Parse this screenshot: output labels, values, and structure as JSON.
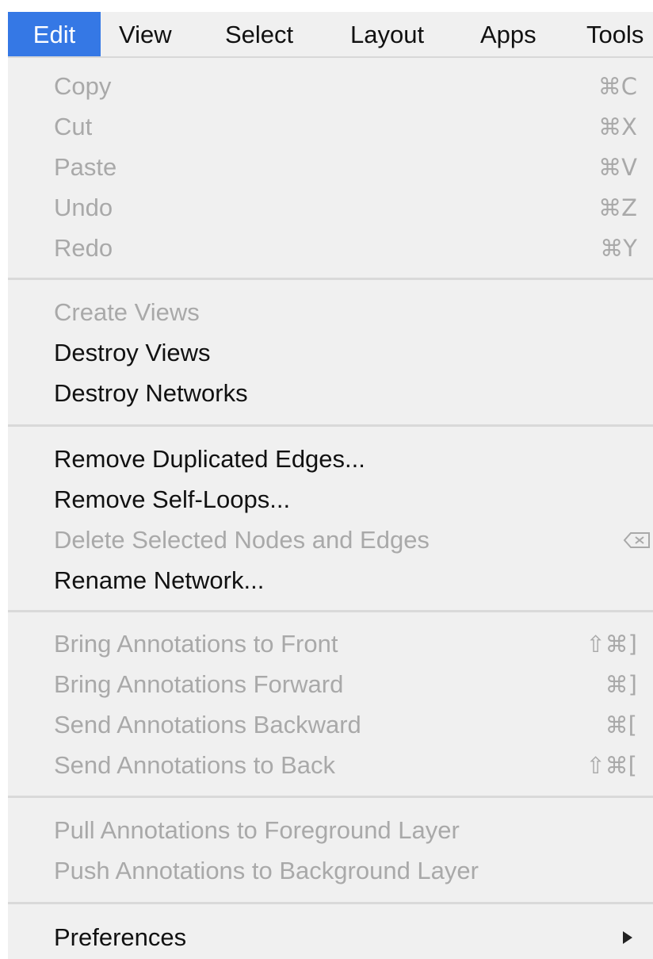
{
  "menubar": {
    "items": [
      {
        "label": "Edit",
        "active": true
      },
      {
        "label": "View",
        "active": false
      },
      {
        "label": "Select",
        "active": false
      },
      {
        "label": "Layout",
        "active": false
      },
      {
        "label": "Apps",
        "active": false
      },
      {
        "label": "Tools",
        "active": false
      }
    ]
  },
  "menu": {
    "groups": [
      {
        "items": [
          {
            "label": "Copy",
            "enabled": false,
            "shortcut": "⌘C"
          },
          {
            "label": "Cut",
            "enabled": false,
            "shortcut": "⌘X"
          },
          {
            "label": "Paste",
            "enabled": false,
            "shortcut": "⌘V"
          },
          {
            "label": "Undo",
            "enabled": false,
            "shortcut": "⌘Z"
          },
          {
            "label": "Redo",
            "enabled": false,
            "shortcut": "⌘Y"
          }
        ]
      },
      {
        "items": [
          {
            "label": "Create Views",
            "enabled": false
          },
          {
            "label": "Destroy Views",
            "enabled": true
          },
          {
            "label": "Destroy Networks",
            "enabled": true
          }
        ]
      },
      {
        "items": [
          {
            "label": "Remove Duplicated Edges...",
            "enabled": true
          },
          {
            "label": "Remove Self-Loops...",
            "enabled": true
          },
          {
            "label": "Delete Selected Nodes and Edges",
            "enabled": false,
            "icon": "delete-key-icon"
          },
          {
            "label": "Rename Network...",
            "enabled": true
          }
        ]
      },
      {
        "items": [
          {
            "label": "Bring Annotations to Front",
            "enabled": false,
            "shortcut": "⇧⌘]"
          },
          {
            "label": "Bring Annotations Forward",
            "enabled": false,
            "shortcut": "⌘]"
          },
          {
            "label": "Send Annotations Backward",
            "enabled": false,
            "shortcut": "⌘["
          },
          {
            "label": "Send Annotations to Back",
            "enabled": false,
            "shortcut": "⇧⌘["
          }
        ]
      },
      {
        "items": [
          {
            "label": "Pull Annotations to Foreground Layer",
            "enabled": false
          },
          {
            "label": "Push Annotations to Background Layer",
            "enabled": false
          }
        ]
      },
      {
        "items": [
          {
            "label": "Preferences",
            "enabled": true,
            "icon": "submenu-arrow-icon"
          }
        ]
      }
    ]
  },
  "colors": {
    "menu_background": "#f0f0f0",
    "active_highlight": "#3578e5",
    "enabled_text": "#111111",
    "disabled_text": "#a9a9a9",
    "separator": "#d9d9d9"
  }
}
